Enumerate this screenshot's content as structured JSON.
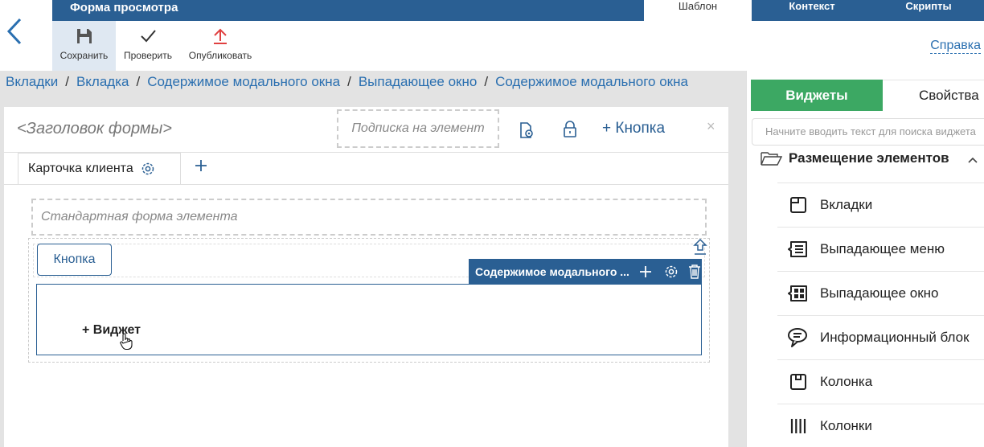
{
  "topbar": {
    "title": "Форма просмотра",
    "tabs": [
      {
        "label": "Шаблон",
        "active": true
      },
      {
        "label": "Контекст",
        "active": false
      },
      {
        "label": "Скрипты",
        "active": false
      }
    ]
  },
  "toolbar": {
    "save_label": "Сохранить",
    "check_label": "Проверить",
    "publish_label": "Опубликовать",
    "help_label": "Справка"
  },
  "breadcrumb": [
    "Вкладки",
    "Вкладка",
    "Содержимое модального окна",
    "Выпадающее окно",
    "Содержимое модального окна"
  ],
  "form": {
    "title_placeholder": "<Заголовок формы>",
    "subscription_placeholder": "Подписка на элемент",
    "add_button_label": "+ Кнопка",
    "close_symbol": "×",
    "tab_label": "Карточка клиента",
    "standard_form_placeholder": "Стандартная форма элемента",
    "button_label": "Кнопка",
    "modal_toolbar_label": "Содержимое модального ...",
    "widget_add_label": "+ Виджет"
  },
  "right_panel": {
    "tabs": [
      {
        "label": "Виджеты",
        "active": true
      },
      {
        "label": "Свойства",
        "active": false
      }
    ],
    "search_placeholder": "Начните вводить текст для поиска виджета",
    "section_label": "Размещение элементов",
    "items": [
      {
        "label": "Вкладки",
        "icon": "tabs-icon"
      },
      {
        "label": "Выпадающее меню",
        "icon": "dropdown-menu-icon"
      },
      {
        "label": "Выпадающее окно",
        "icon": "popup-window-icon"
      },
      {
        "label": "Информационный блок",
        "icon": "info-block-icon"
      },
      {
        "label": "Колонка",
        "icon": "column-icon"
      },
      {
        "label": "Колонки",
        "icon": "columns-icon"
      }
    ]
  },
  "colors": {
    "primary": "#2a5f93",
    "accent_green": "#3ca863",
    "link": "#2a6fb0",
    "publish_red": "#e04040",
    "background_gray": "#e3e3e3"
  }
}
